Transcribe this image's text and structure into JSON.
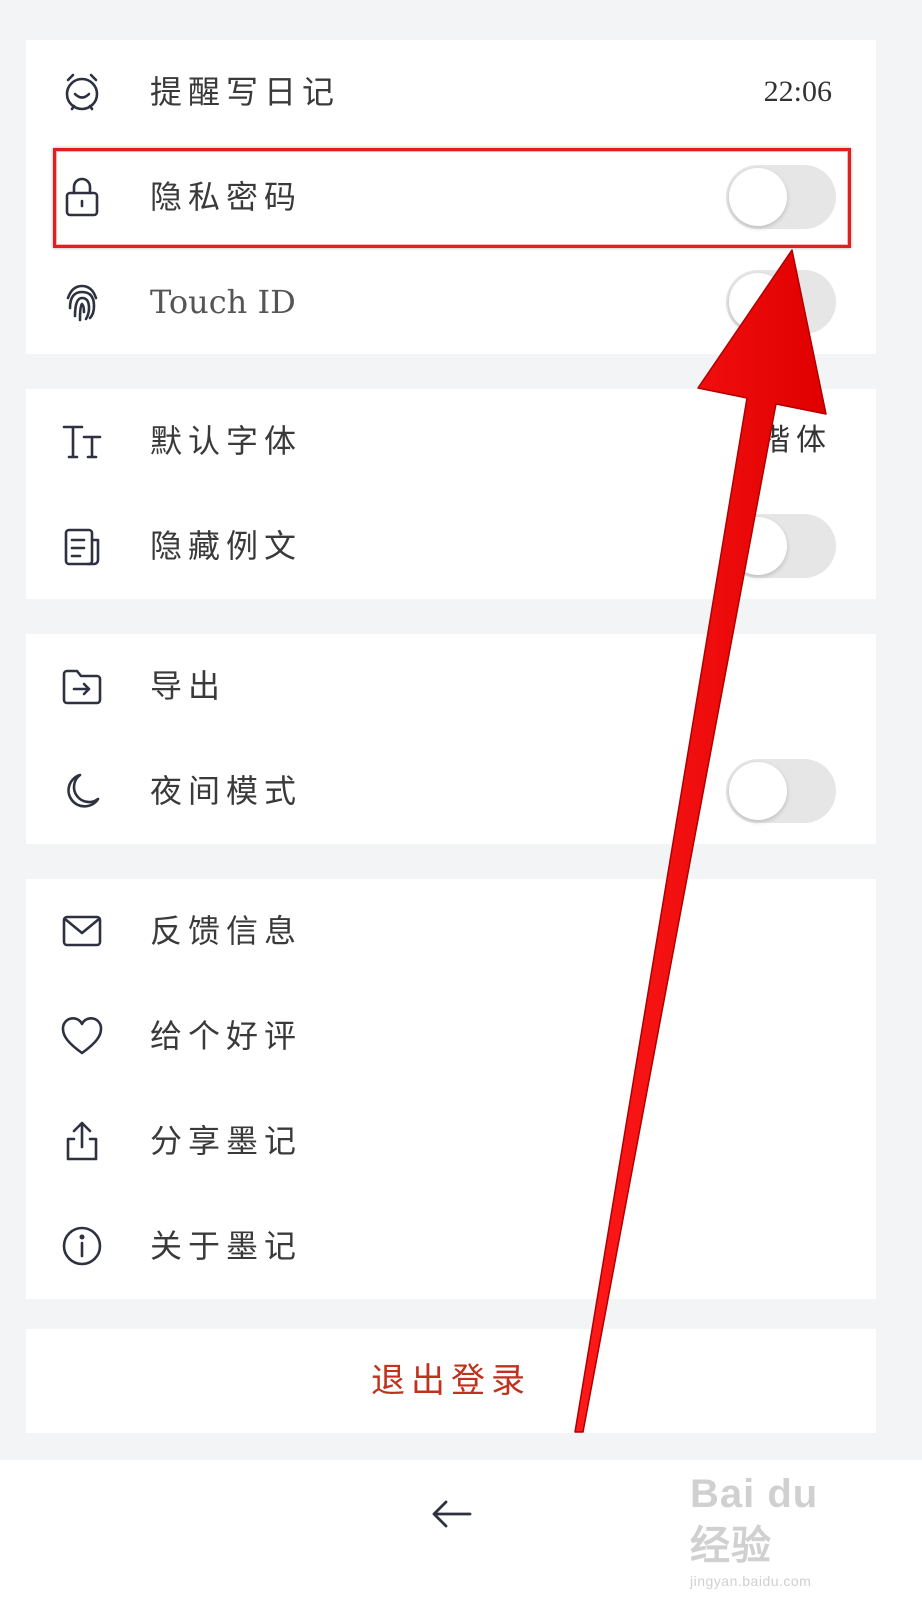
{
  "settings": {
    "group1": {
      "reminder": {
        "label": "提醒写日记",
        "icon": "alarm-clock-icon",
        "value": "22:06"
      },
      "privacy_password": {
        "label": "隐私密码",
        "icon": "lock-icon",
        "enabled": false
      },
      "touch_id": {
        "label": "Touch ID",
        "icon": "fingerprint-icon",
        "enabled": false
      }
    },
    "group2": {
      "default_font": {
        "label": "默认字体",
        "icon": "text-size-icon",
        "value": "楷体"
      },
      "hide_sample": {
        "label": "隐藏例文",
        "icon": "document-icon",
        "enabled": false
      }
    },
    "group3": {
      "export": {
        "label": "导出",
        "icon": "folder-export-icon"
      },
      "night_mode": {
        "label": "夜间模式",
        "icon": "moon-icon",
        "enabled": false
      }
    },
    "group4": {
      "feedback": {
        "label": "反馈信息",
        "icon": "mail-icon"
      },
      "rate": {
        "label": "给个好评",
        "icon": "heart-icon"
      },
      "share": {
        "label": "分享墨记",
        "icon": "share-icon"
      },
      "about": {
        "label": "关于墨记",
        "icon": "info-icon"
      }
    },
    "logout": {
      "label": "退出登录"
    }
  },
  "nav": {
    "back_icon": "back-arrow-icon"
  },
  "watermark": {
    "brand": "Bai du 经验",
    "url": "jingyan.baidu.com"
  },
  "colors": {
    "background": "#f3f4f6",
    "card": "#ffffff",
    "logout_text": "#c0321e",
    "annotation_red": "#e02020",
    "toggle_off": "#e6e6e6"
  }
}
